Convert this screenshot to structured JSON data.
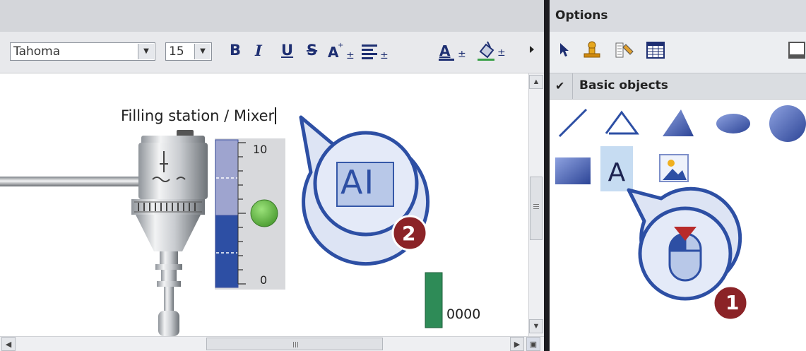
{
  "editor": {
    "font_name": "Tahoma",
    "font_size": "15",
    "format_buttons": [
      "B",
      "I",
      "U",
      "S",
      "A"
    ],
    "text_object": "Filling station / Mixer",
    "bar_scale_top": "10",
    "bar_scale_bottom": "0",
    "io_field_value": "0000"
  },
  "options_panel": {
    "title": "Options",
    "section_title": "Basic objects"
  },
  "objects": [
    "line",
    "polyline",
    "polygon",
    "ellipse",
    "circle",
    "rectangle",
    "text-field",
    "graphic-view"
  ],
  "callouts": {
    "step1": "1",
    "step2": "2",
    "step2_icon_text": "AI"
  },
  "colors": {
    "accent_blue": "#2d4fa4",
    "step_badge": "#8b2327",
    "green_indicator": "#6ec24a",
    "io_green": "#2e8b57"
  }
}
